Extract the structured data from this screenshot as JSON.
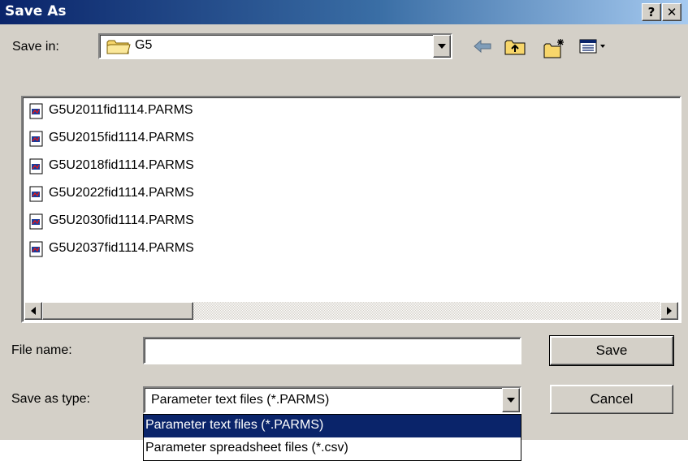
{
  "window": {
    "title": "Save As",
    "help_label": "?",
    "close_label": "✕"
  },
  "save_in": {
    "label": "Save in:",
    "value": "G5",
    "icons": [
      "folder-icon",
      "back-arrow-icon",
      "up-folder-icon",
      "new-folder-icon",
      "view-menu-icon"
    ]
  },
  "files": [
    {
      "name": "G5U2011fid1114.PARMS"
    },
    {
      "name": "G5U2015fid1114.PARMS"
    },
    {
      "name": "G5U2018fid1114.PARMS"
    },
    {
      "name": "G5U2022fid1114.PARMS"
    },
    {
      "name": "G5U2030fid1114.PARMS"
    },
    {
      "name": "G5U2037fid1114.PARMS"
    }
  ],
  "file_name": {
    "label": "File name:",
    "value": ""
  },
  "save_as_type": {
    "label": "Save as type:",
    "value": "Parameter text files (*.PARMS)",
    "options": [
      {
        "label": "Parameter text files (*.PARMS)",
        "selected": true
      },
      {
        "label": "Parameter spreadsheet files (*.csv)",
        "selected": false
      }
    ]
  },
  "buttons": {
    "save_label": "Save",
    "cancel_label": "Cancel"
  },
  "colors": {
    "title_bar": "#0a246a",
    "dialog_face": "#d4d0c8",
    "selection": "#0a246a"
  }
}
